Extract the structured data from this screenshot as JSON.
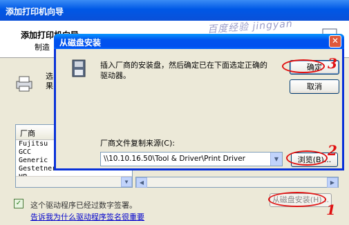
{
  "wizard": {
    "title": "添加打印机向导",
    "header_title": "添加打印机向导",
    "header_subtitle": "制造",
    "body_text_line1": "选",
    "body_text_line2": "果",
    "manufacturer_list": {
      "header": "厂商",
      "items": [
        "Fujitsu",
        "GCC",
        "Generic",
        "Gestetner",
        "HP"
      ]
    },
    "signature_text": "这个驱动程序已经过数字签署。",
    "signature_link": "告诉我为什么驱动程序签名很重要",
    "disk_button_label": "从磁盘安装(H)..."
  },
  "dialog": {
    "title": "从磁盘安装",
    "message": "插入厂商的安装盘，然后确定已在下面选定正确的驱动器。",
    "ok_label": "确定",
    "cancel_label": "取消",
    "source_label": "厂商文件复制来源(C):",
    "source_value": "\\\\10.10.16.50\\Tool & Driver\\Print Driver",
    "browse_label": "浏览(B)..."
  },
  "watermark": "百度经验 jingyan",
  "annotations": [
    "1",
    "2",
    "3"
  ],
  "colors": {
    "titlebar": "#0058e6",
    "dialog_border": "#0831d9",
    "annotation_red": "#e01010",
    "link_blue": "#0000cc"
  }
}
